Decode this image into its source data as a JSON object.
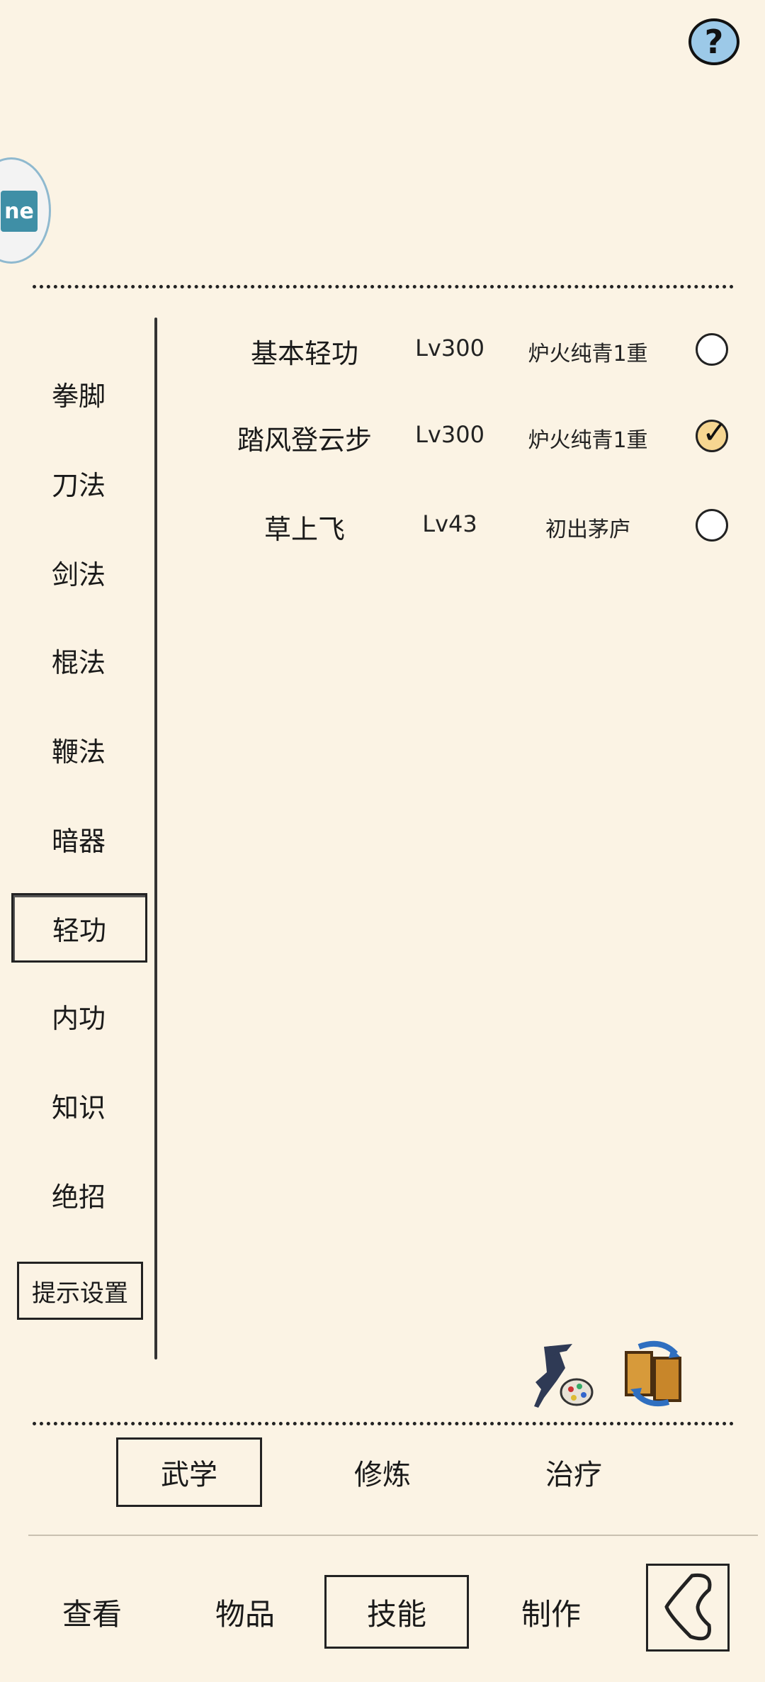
{
  "header": {
    "help_icon": "?",
    "avatar_text": "ne"
  },
  "categories": [
    {
      "label": "拳脚",
      "active": false
    },
    {
      "label": "刀法",
      "active": false
    },
    {
      "label": "剑法",
      "active": false
    },
    {
      "label": "棍法",
      "active": false
    },
    {
      "label": "鞭法",
      "active": false
    },
    {
      "label": "暗器",
      "active": false
    },
    {
      "label": "轻功",
      "active": true
    },
    {
      "label": "内功",
      "active": false
    },
    {
      "label": "知识",
      "active": false
    },
    {
      "label": "绝招",
      "active": false
    }
  ],
  "hint_settings": "提示设置",
  "skills": [
    {
      "name": "基本轻功",
      "level": "Lv300",
      "realm": "炉火纯青1重",
      "checked": false
    },
    {
      "name": "踏风登云步",
      "level": "Lv300",
      "realm": "炉火纯青1重",
      "checked": true
    },
    {
      "name": "草上飞",
      "level": "Lv43",
      "realm": "初出茅庐",
      "checked": false
    }
  ],
  "action_icons": [
    "martial-artist-palette-icon",
    "scroll-swap-icon"
  ],
  "sub_tabs": [
    {
      "label": "武学",
      "active": true
    },
    {
      "label": "修炼",
      "active": false
    },
    {
      "label": "治疗",
      "active": false
    }
  ],
  "bottom_nav": [
    {
      "label": "查看",
      "active": false
    },
    {
      "label": "物品",
      "active": false
    },
    {
      "label": "技能",
      "active": true
    },
    {
      "label": "制作",
      "active": false
    }
  ],
  "colors": {
    "background": "#fbf3e4",
    "help_bg": "#9cc9e8",
    "checked_radio": "#f6d691",
    "avatar_accent": "#3f8fa6"
  }
}
